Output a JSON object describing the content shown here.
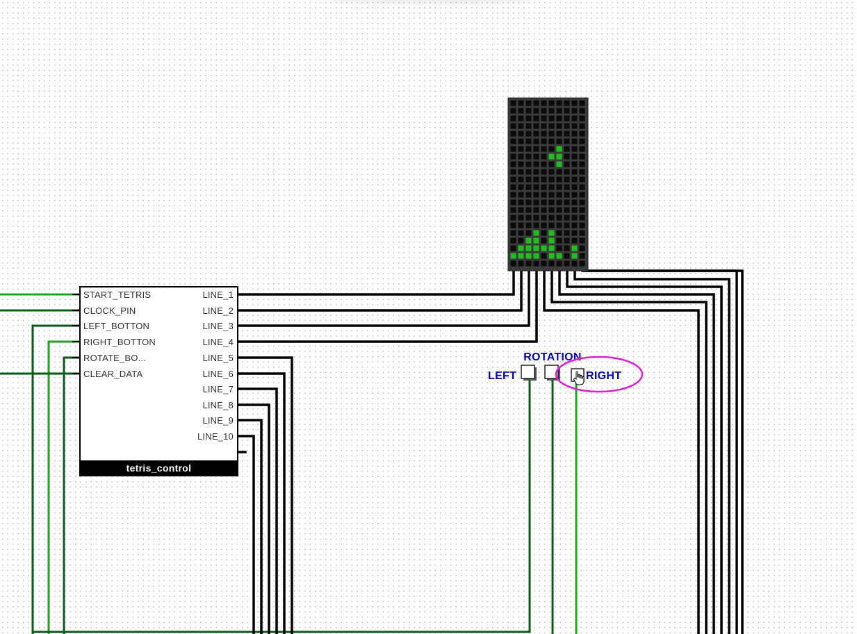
{
  "component": {
    "title": "tetris_control",
    "inputs": [
      "START_TETRIS",
      "CLOCK_PIN",
      "LEFT_BOTTON",
      "RIGHT_BOTTON",
      "ROTATE_BO...",
      "CLEAR_DATA"
    ],
    "outputs": [
      "LINE_1",
      "LINE_2",
      "LINE_3",
      "LINE_4",
      "LINE_5",
      "LINE_6",
      "LINE_7",
      "LINE_8",
      "LINE_9",
      "LINE_10"
    ]
  },
  "buttons": {
    "left_label": "LEFT",
    "rotation_label": "ROTATION",
    "right_label": "RIGHT"
  },
  "led_matrix": {
    "columns": 10,
    "rows": 20,
    "lit": [
      [
        6,
        6
      ],
      [
        5,
        7
      ],
      [
        6,
        7
      ],
      [
        6,
        8
      ],
      [
        3,
        17
      ],
      [
        5,
        17
      ],
      [
        2,
        18
      ],
      [
        3,
        18
      ],
      [
        5,
        18
      ],
      [
        1,
        19
      ],
      [
        2,
        19
      ],
      [
        3,
        19
      ],
      [
        4,
        19
      ],
      [
        5,
        19
      ],
      [
        8,
        19
      ],
      [
        0,
        20
      ],
      [
        1,
        20
      ],
      [
        2,
        20
      ],
      [
        3,
        20
      ],
      [
        5,
        20
      ],
      [
        6,
        20
      ],
      [
        8,
        20
      ]
    ]
  },
  "colors": {
    "wire_bus": "#000000",
    "wire_signal_dark": "#0e5a1a",
    "wire_signal_bright": "#1aa51a",
    "led_on": "#22bb22",
    "led_off": "#0b0b0b",
    "matrix_bg": "#3a3a3a",
    "label_blue": "#0000b4",
    "highlight": "#e01cd2",
    "title_bar": "#000000"
  },
  "icons": {
    "cursor": "hand-pointer-icon"
  }
}
